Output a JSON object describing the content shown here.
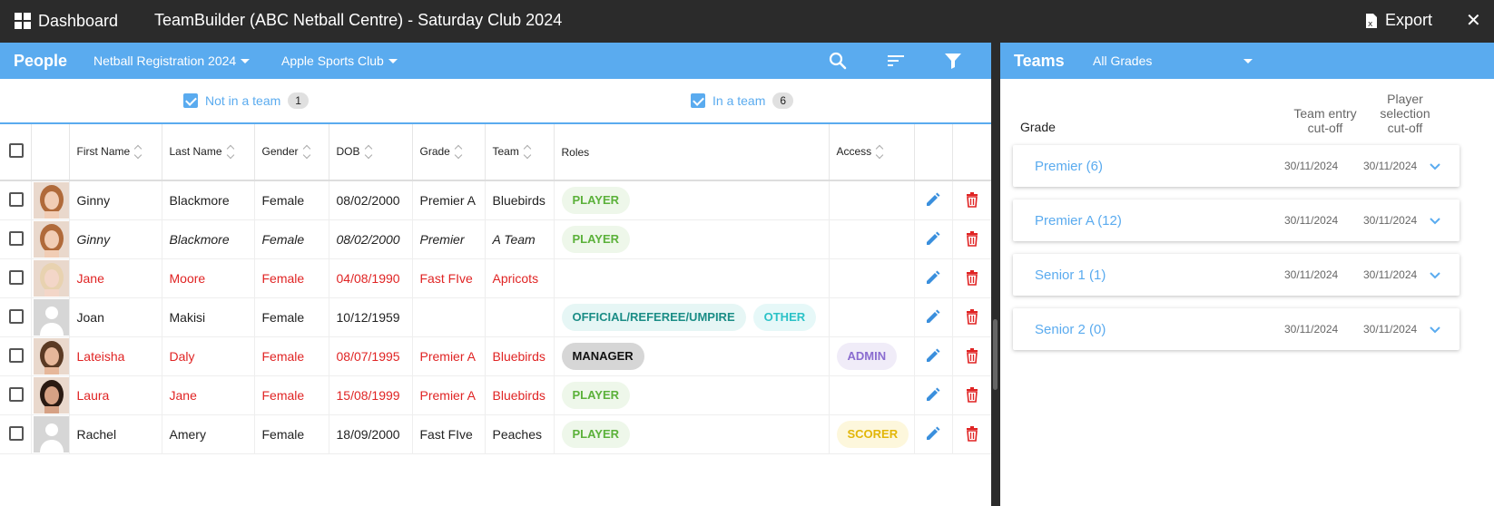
{
  "topbar": {
    "dashboard_label": "Dashboard",
    "title": "TeamBuilder (ABC Netball Centre) - Saturday Club 2024",
    "export_label": "Export",
    "close_glyph": "✕"
  },
  "people": {
    "title": "People",
    "registration": "Netball Registration 2024",
    "club": "Apple Sports Club",
    "icons": [
      "search-icon",
      "sort-icon",
      "filter-icon"
    ],
    "filters": {
      "not_in_team_label": "Not in a team",
      "not_in_team_count": "1",
      "in_team_label": "In a team",
      "in_team_count": "6"
    },
    "columns": [
      "First Name",
      "Last Name",
      "Gender",
      "DOB",
      "Grade",
      "Team",
      "Roles",
      "Access"
    ],
    "rows": [
      {
        "first": "Ginny",
        "last": "Blackmore",
        "gender": "Female",
        "dob": "08/02/2000",
        "grade": "Premier A",
        "team": "Bluebirds",
        "roles": [
          "PLAYER"
        ],
        "access": ""
      },
      {
        "first": "Ginny",
        "last": "Blackmore",
        "gender": "Female",
        "dob": "08/02/2000",
        "grade": "Premier",
        "team": "A Team",
        "roles": [
          "PLAYER"
        ],
        "access": ""
      },
      {
        "first": "Jane",
        "last": "Moore",
        "gender": "Female",
        "dob": "04/08/1990",
        "grade": "Fast FIve",
        "team": "Apricots",
        "roles": [],
        "access": ""
      },
      {
        "first": "Joan",
        "last": "Makisi",
        "gender": "Female",
        "dob": "10/12/1959",
        "grade": "",
        "team": "",
        "roles": [
          "OFFICIAL/REFEREE/UMPIRE",
          "OTHER"
        ],
        "access": ""
      },
      {
        "first": "Lateisha",
        "last": "Daly",
        "gender": "Female",
        "dob": "08/07/1995",
        "grade": "Premier A",
        "team": "Bluebirds",
        "roles": [
          "MANAGER"
        ],
        "access": "ADMIN"
      },
      {
        "first": "Laura",
        "last": "Jane",
        "gender": "Female",
        "dob": "15/08/1999",
        "grade": "Premier A",
        "team": "Bluebirds",
        "roles": [
          "PLAYER"
        ],
        "access": ""
      },
      {
        "first": "Rachel",
        "last": "Amery",
        "gender": "Female",
        "dob": "18/09/2000",
        "grade": "Fast FIve",
        "team": "Peaches",
        "roles": [
          "PLAYER"
        ],
        "access": "SCORER"
      }
    ]
  },
  "teams": {
    "title": "Teams",
    "grade_filter": "All Grades",
    "grade_col": "Grade",
    "entry_cutoff_label": "Team entry cut-off",
    "selection_cutoff_label": "Player selection cut-off",
    "cards": [
      {
        "name": "Premier (6)",
        "entry": "30/11/2024",
        "selection": "30/11/2024"
      },
      {
        "name": "Premier A (12)",
        "entry": "30/11/2024",
        "selection": "30/11/2024"
      },
      {
        "name": "Senior 1 (1)",
        "entry": "30/11/2024",
        "selection": "30/11/2024"
      },
      {
        "name": "Senior 2 (0)",
        "entry": "30/11/2024",
        "selection": "30/11/2024"
      }
    ]
  },
  "colors": {
    "accent": "#5aabef",
    "danger": "#e02424",
    "topbar": "#2b2b2b"
  }
}
